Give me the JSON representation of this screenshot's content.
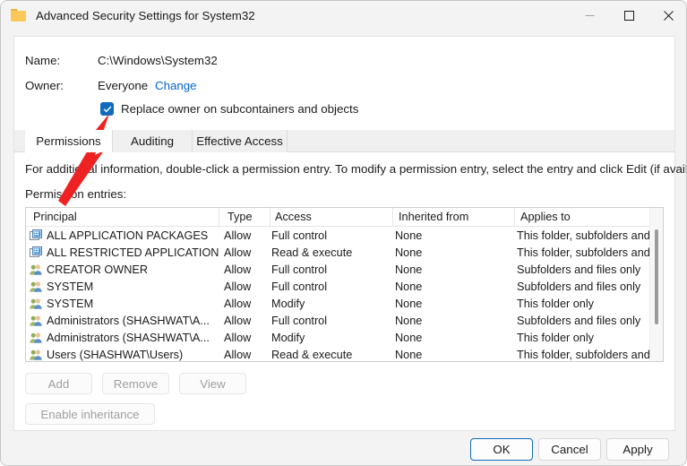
{
  "window": {
    "title": "Advanced Security Settings for System32",
    "icon": "folder-icon",
    "controls": {
      "minimize": "—",
      "maximize": "□",
      "close": "✕"
    }
  },
  "header": {
    "name_label": "Name:",
    "name_value": "C:\\Windows\\System32",
    "owner_label": "Owner:",
    "owner_value": "Everyone",
    "change_link": "Change",
    "replace_owner_label": "Replace owner on subcontainers and objects",
    "replace_owner_checked": true
  },
  "tabs": [
    {
      "label": "Permissions",
      "active": true
    },
    {
      "label": "Auditing",
      "active": false
    },
    {
      "label": "Effective Access",
      "active": false
    }
  ],
  "body": {
    "instruction": "For additional information, double-click a permission entry. To modify a permission entry, select the entry and click Edit (if available).",
    "entries_label": "Permission entries:"
  },
  "table": {
    "columns": [
      "Principal",
      "Type",
      "Access",
      "Inherited from",
      "Applies to"
    ],
    "rows": [
      {
        "icon": "app-package-icon",
        "principal": "ALL APPLICATION PACKAGES",
        "type": "Allow",
        "access": "Full control",
        "inherited": "None",
        "applies": "This folder, subfolders and files"
      },
      {
        "icon": "app-package-icon",
        "principal": "ALL RESTRICTED APPLICATION...",
        "type": "Allow",
        "access": "Read & execute",
        "inherited": "None",
        "applies": "This folder, subfolders and files"
      },
      {
        "icon": "user-group-icon",
        "principal": "CREATOR OWNER",
        "type": "Allow",
        "access": "Full control",
        "inherited": "None",
        "applies": "Subfolders and files only"
      },
      {
        "icon": "user-group-icon",
        "principal": "SYSTEM",
        "type": "Allow",
        "access": "Full control",
        "inherited": "None",
        "applies": "Subfolders and files only"
      },
      {
        "icon": "user-group-icon",
        "principal": "SYSTEM",
        "type": "Allow",
        "access": "Modify",
        "inherited": "None",
        "applies": "This folder only"
      },
      {
        "icon": "user-group-icon",
        "principal": "Administrators (SHASHWAT\\A...",
        "type": "Allow",
        "access": "Full control",
        "inherited": "None",
        "applies": "Subfolders and files only"
      },
      {
        "icon": "user-group-icon",
        "principal": "Administrators (SHASHWAT\\A...",
        "type": "Allow",
        "access": "Modify",
        "inherited": "None",
        "applies": "This folder only"
      },
      {
        "icon": "user-group-icon",
        "principal": "Users (SHASHWAT\\Users)",
        "type": "Allow",
        "access": "Read & execute",
        "inherited": "None",
        "applies": "This folder, subfolders and files"
      }
    ]
  },
  "actions": {
    "add": "Add",
    "remove": "Remove",
    "view": "View",
    "enable_inheritance": "Enable inheritance"
  },
  "footer": {
    "ok": "OK",
    "cancel": "Cancel",
    "apply": "Apply"
  },
  "annotation": {
    "type": "arrow",
    "color": "#ee2222",
    "points_at": "replace-owner-checkbox"
  },
  "colors": {
    "accent": "#0f6cbd",
    "link": "#0066cc",
    "window_bg": "#f3f3f3",
    "panel_bg": "#ffffff",
    "annotation_red": "#ee2222"
  }
}
